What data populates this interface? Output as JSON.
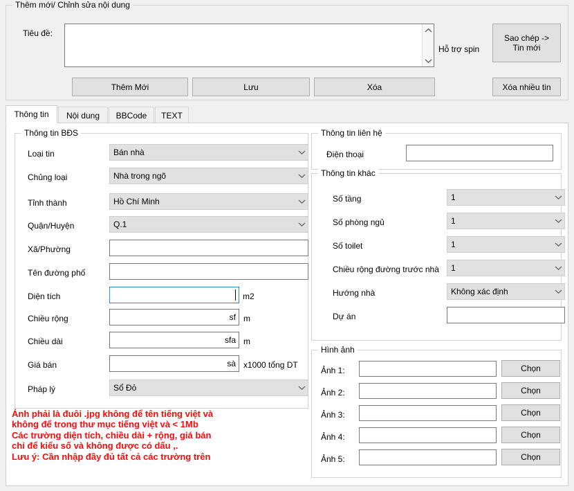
{
  "top_group": {
    "legend": "Thêm mới/ Chỉnh sửa nội dung",
    "title_label": "Tiêu đề:",
    "title_value": "",
    "title_placeholder": "",
    "spin_label": "Hỗ trợ spin",
    "copy_button": "Sao chép ->\nTin mới",
    "buttons": [
      {
        "name": "add-new",
        "label": "Thêm Mới"
      },
      {
        "name": "save",
        "label": "Lưu"
      },
      {
        "name": "delete",
        "label": "Xóa"
      },
      {
        "name": "delete-many",
        "label": "Xóa nhiều tin"
      }
    ],
    "scroll_up_icon": "chevron-up-icon",
    "scroll_down_icon": "chevron-down-icon"
  },
  "tabs": [
    {
      "label": "Thông tin",
      "active": true
    },
    {
      "label": "Nội dung",
      "active": false
    },
    {
      "label": "BBCode",
      "active": false
    },
    {
      "label": "TEXT",
      "active": false
    }
  ],
  "bds_group": {
    "legend": "Thông tin BĐS",
    "fields": [
      {
        "label": "Loại tin",
        "type": "combo",
        "value": "Bán nhà"
      },
      {
        "label": "Chủng loại",
        "type": "combo",
        "value": "Nhà trong ngõ"
      },
      {
        "label": "Tỉnh thành",
        "type": "combo",
        "value": "Hồ Chí Minh"
      },
      {
        "label": "Quận/Huyện",
        "type": "combo",
        "value": "Q.1"
      },
      {
        "label": "Xã/Phường",
        "type": "text",
        "value": ""
      },
      {
        "label": "Tên đường phố",
        "type": "text",
        "value": ""
      },
      {
        "label": "Diện tích",
        "type": "text",
        "value": "",
        "suffix": "m2",
        "focused": true
      },
      {
        "label": "Chiều rộng",
        "type": "text",
        "value": "sf",
        "suffix": "m",
        "align": "right"
      },
      {
        "label": "Chiều dài",
        "type": "text",
        "value": "sfa",
        "suffix": "m",
        "align": "right"
      },
      {
        "label": "Giá bán",
        "type": "text",
        "value": "sà",
        "suffix": "x1000 tổng DT",
        "align": "right"
      },
      {
        "label": "Pháp lý",
        "type": "combo",
        "value": "Sổ Đỏ"
      }
    ]
  },
  "contact_group": {
    "legend": "Thông tin liên hệ",
    "phone_label": "Điện thoại",
    "phone_value": ""
  },
  "other_group": {
    "legend": "Thông tin khác",
    "fields": [
      {
        "label": "Số tầng",
        "type": "combo",
        "value": "1"
      },
      {
        "label": "Số phòng ngủ",
        "type": "combo",
        "value": "1"
      },
      {
        "label": "Số toilet",
        "type": "combo",
        "value": "1"
      },
      {
        "label": "Chiều rộng đường trước nhà",
        "type": "combo",
        "value": "1"
      },
      {
        "label": "Hướng nhà",
        "type": "combo",
        "value": "Không xác định"
      },
      {
        "label": "Dự án",
        "type": "text",
        "value": ""
      }
    ]
  },
  "image_group": {
    "legend": "Hình ảnh",
    "choose_label": "Chọn",
    "rows": [
      {
        "label": "Ảnh 1:",
        "value": ""
      },
      {
        "label": "Ảnh 2:",
        "value": ""
      },
      {
        "label": "Ảnh 3:",
        "value": ""
      },
      {
        "label": "Ảnh 4:",
        "value": ""
      },
      {
        "label": "Ảnh 5:",
        "value": ""
      }
    ]
  },
  "warnings": [
    "Ảnh phải là đuôi .jpg không để tên tiếng việt và\n không để trong thư mục tiếng việt và < 1Mb",
    "Các trường diện tích, chiều dài + rộng, giá bán\nchỉ để kiểu số và không được có dấu ,.",
    "Lưu ý: Cần nhập đầy đủ tất cả các trường trên"
  ],
  "colors": {
    "window_bg": "#f0f0f0",
    "panel_bg": "#ffffff",
    "combo_bg": "#e1e1e1",
    "button_bg": "#e1e1e1",
    "input_border": "#7a7a7a",
    "focus_border": "#2a8cd4",
    "warning_text": "#fb0a0a"
  }
}
